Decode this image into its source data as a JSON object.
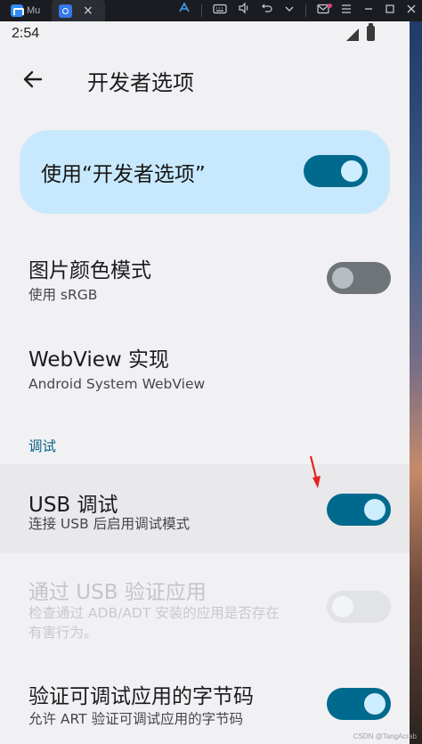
{
  "emulator": {
    "tab1_label": "Mu",
    "close_glyph": "×",
    "tools": [
      "app-store-icon",
      "keyboard-icon",
      "volume-icon",
      "rotate-icon",
      "chevron-down-icon",
      "mail-icon",
      "menu-icon",
      "minimize-icon",
      "maximize-icon",
      "close-icon"
    ],
    "accent": "#2f8cf4"
  },
  "status_bar": {
    "time": "2:54"
  },
  "app_bar": {
    "title": "开发者选项"
  },
  "master": {
    "label": "使用“开发者选项”",
    "enabled": true
  },
  "prefs": [
    {
      "title": "图片颜色模式",
      "summary": "使用 sRGB",
      "switch": "off"
    },
    {
      "title": "WebView 实现",
      "summary": "Android System WebView",
      "switch": null
    }
  ],
  "debug_section": {
    "header": "调试",
    "items": [
      {
        "title": "USB 调试",
        "summary": "连接 USB 后启用调试模式",
        "switch": "on"
      },
      {
        "title": "通过 USB 验证应用",
        "summary_line1": "检查通过 ADB/ADT 安装的应用是否存在",
        "summary_line2": "有害行为。",
        "switch": "disabled"
      },
      {
        "title": "验证可调试应用的字节码",
        "summary": "允许 ART 验证可调试应用的字节码",
        "switch": "on"
      }
    ]
  },
  "watermark": "CSDN @TangAcrab",
  "colors": {
    "switch_on": "#006a8e",
    "master_card": "#c8e9fd",
    "section_header": "#0a6487",
    "annotation_arrow": "#e52320"
  }
}
